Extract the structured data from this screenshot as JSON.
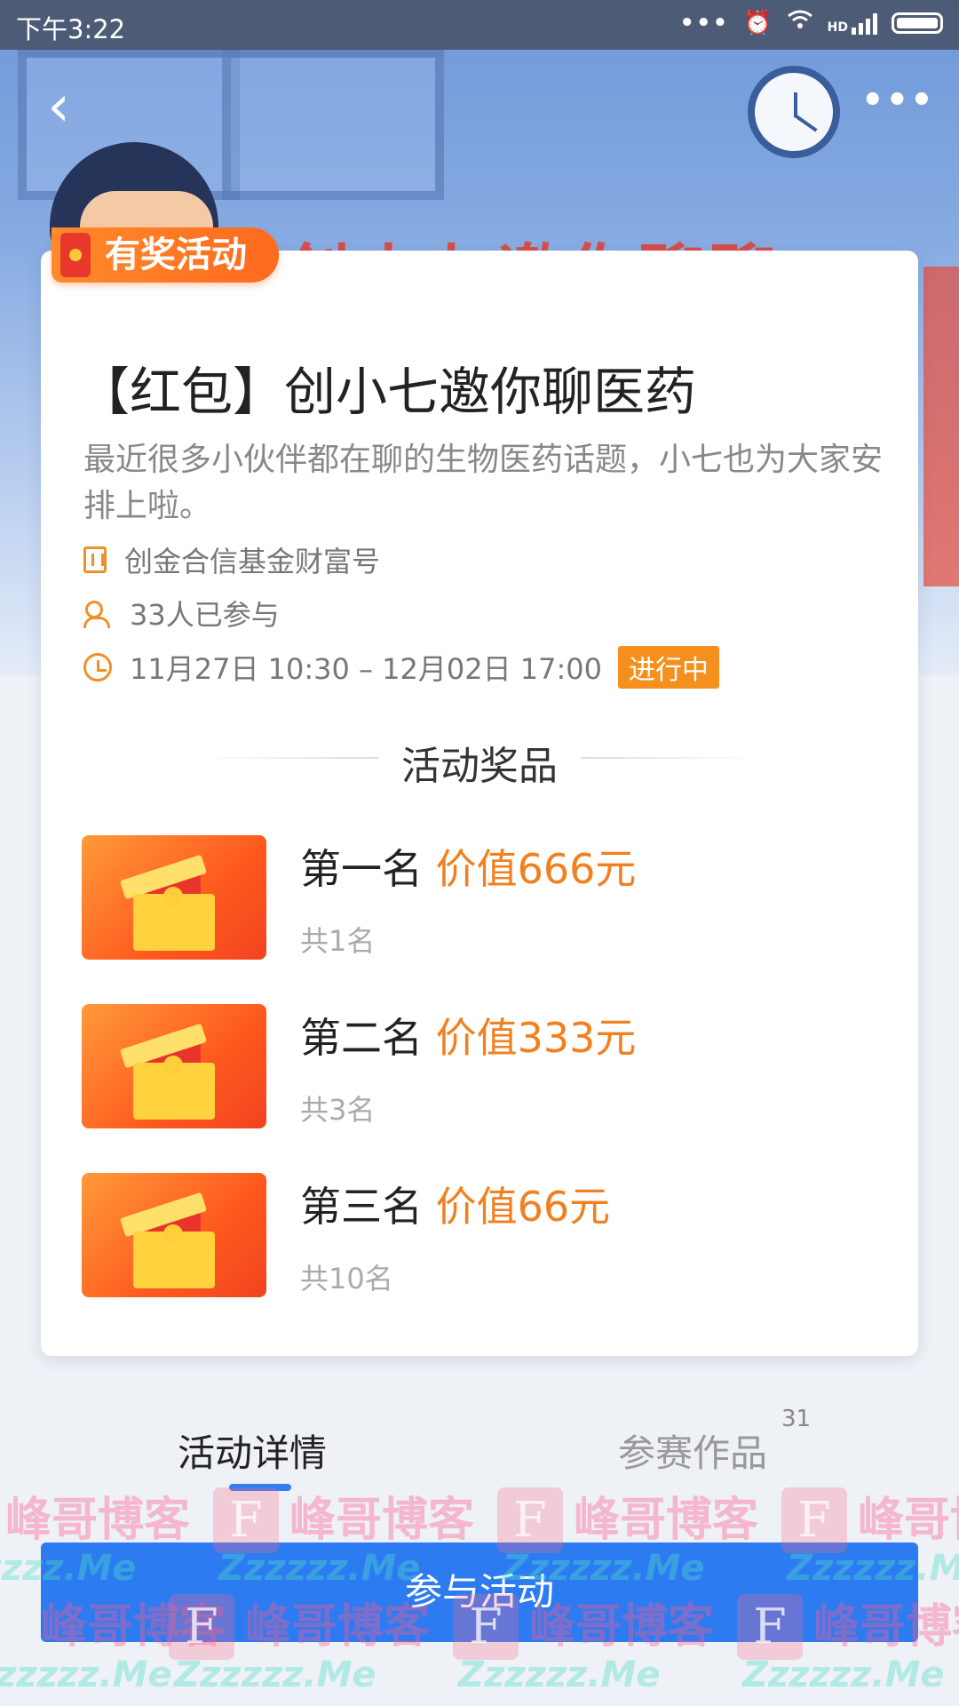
{
  "status_bar": {
    "time": "下午3:22",
    "dots": "•••",
    "hd_label": "HD"
  },
  "nav": {
    "back_symbol": "‹",
    "more_symbol": "•••"
  },
  "hero": {
    "banner_text": "创小七邀你聊聊"
  },
  "badge": {
    "label": "有奖活动"
  },
  "activity": {
    "title": "【红包】创小七邀你聊医药",
    "description": "最近很多小伙伴都在聊的生物医药话题，小七也为大家安排上啦。",
    "organizer": "创金合信基金财富号",
    "participants": "33人已参与",
    "time_range": "11月27日 10:30 – 12月02日 17:00",
    "status": "进行中"
  },
  "prizes": {
    "heading": "活动奖品",
    "items": [
      {
        "rank": "第一名",
        "value": "价值666元",
        "count": "共1名"
      },
      {
        "rank": "第二名",
        "value": "价值333元",
        "count": "共3名"
      },
      {
        "rank": "第三名",
        "value": "价值66元",
        "count": "共10名"
      }
    ]
  },
  "tabs": {
    "details": "活动详情",
    "works": "参赛作品",
    "works_count": "31"
  },
  "join_button": {
    "label": "参与活动"
  },
  "watermark": {
    "logo_letter": "F",
    "cn_text": "峰哥博客",
    "en_text": "Zzzzzz.Me"
  },
  "colors": {
    "accent_blue": "#2d7bf0",
    "accent_orange": "#f08020",
    "status_tag": "#f5901e"
  }
}
